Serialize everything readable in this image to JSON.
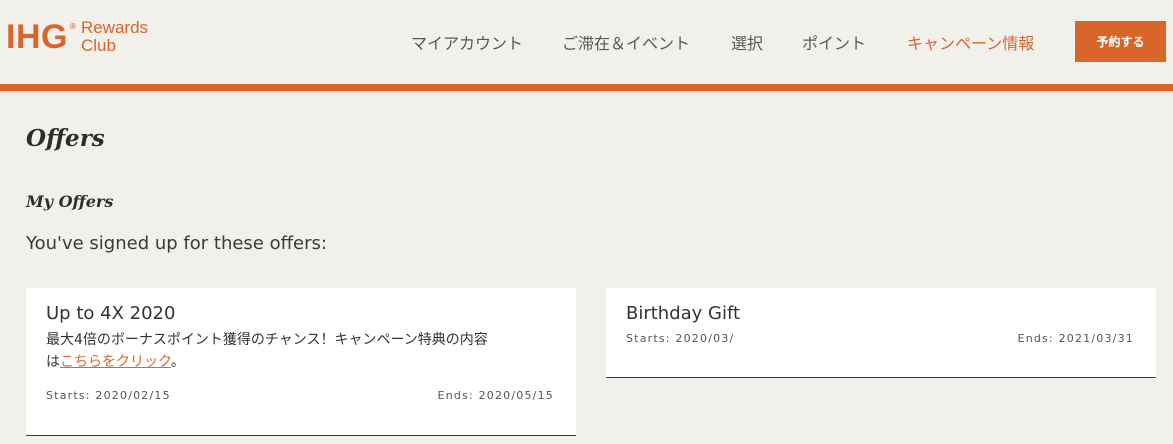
{
  "header": {
    "logo": {
      "brand": "IHG",
      "reg_mark": "®",
      "line1": "Rewards",
      "line2": "Club"
    },
    "nav": [
      {
        "label": "マイアカウント",
        "active": false
      },
      {
        "label": "ご滞在＆イベント",
        "active": false
      },
      {
        "label": "選択",
        "active": false
      },
      {
        "label": "ポイント",
        "active": false
      },
      {
        "label": "キャンペーン情報",
        "active": true
      }
    ],
    "book_button": "予約する"
  },
  "main": {
    "page_title": "Offers",
    "section_title": "My Offers",
    "intro": "You've signed up for these offers:",
    "offers": [
      {
        "title": "Up to 4X 2020",
        "desc_line1": "最大4倍のボーナスポイント獲得のチャンス！キャンペーン特典の内容",
        "desc_prefix": "は",
        "desc_link": "こちらをクリック",
        "desc_suffix": "。",
        "starts": "Starts: 2020/02/15",
        "ends": "Ends: 2020/05/15"
      },
      {
        "title": "Birthday Gift",
        "starts": "Starts: 2020/03/",
        "ends": "Ends: 2021/03/31"
      }
    ]
  },
  "colors": {
    "accent": "#d9652b",
    "background": "#f2f0eb",
    "card": "#ffffff",
    "text": "#2d2d2d"
  }
}
